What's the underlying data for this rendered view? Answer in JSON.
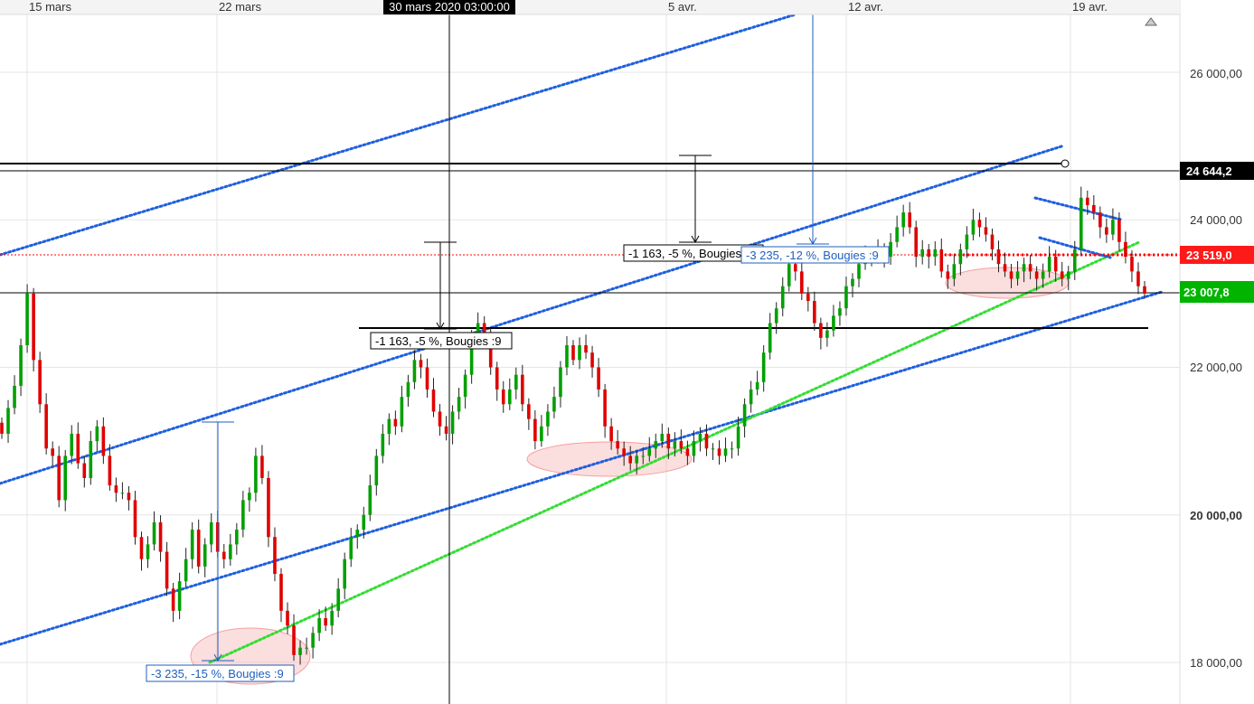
{
  "chart_data": {
    "type": "candlestick",
    "x_ticks": [
      "15 mars",
      "22 mars",
      "5 avr.",
      "12 avr.",
      "19 avr."
    ],
    "crosshair_label": "30 mars 2020 03:00:00",
    "y_ticks": [
      "26 000,00",
      "24 000,00",
      "22 000,00",
      "20 000,00",
      "18 000,00"
    ],
    "y_tick_values": [
      26000,
      24000,
      22000,
      20000,
      18000
    ],
    "ylim": [
      17500,
      26800
    ],
    "price_tags": [
      {
        "label": "24 644,2",
        "value": 24644.2,
        "color": "#000000"
      },
      {
        "label": "23 519,0",
        "value": 23519.0,
        "color": "#ff0000"
      },
      {
        "label": "23 007,8",
        "value": 23007.8,
        "color": "#00b400"
      }
    ],
    "annotations": [
      {
        "text": "-1 163, -5 %, Bougies :9",
        "color": "#000000"
      },
      {
        "text": "-1 163, -5 %, Bougies :9",
        "color": "#000000"
      },
      {
        "text": "-3 235, -12 %, Bougies :9",
        "color": "#1f5fbf"
      },
      {
        "text": "-3 235, -15 %, Bougies :9",
        "color": "#1f5fbf"
      }
    ],
    "colors": {
      "up": "#00a000",
      "down": "#e00000",
      "channel": "#1f5fdf",
      "support": "#33dd33",
      "ellipse": "#f4a0a0"
    },
    "closes": [
      21100,
      21450,
      21750,
      22300,
      23000,
      22100,
      21500,
      20900,
      20800,
      20200,
      20800,
      21100,
      20700,
      20500,
      21000,
      21200,
      20800,
      20400,
      20300,
      20300,
      20200,
      19700,
      19400,
      19600,
      19900,
      19500,
      19000,
      18700,
      19100,
      19400,
      19800,
      19300,
      19600,
      19900,
      19500,
      19400,
      19600,
      19800,
      20200,
      20300,
      20800,
      20500,
      19700,
      19200,
      18700,
      18500,
      18100,
      18200,
      18200,
      18400,
      18600,
      18500,
      18700,
      19000,
      19400,
      19700,
      19800,
      20000,
      20400,
      20800,
      21100,
      21300,
      21200,
      21600,
      21800,
      22100,
      22000,
      21700,
      21400,
      21200,
      21100,
      21400,
      21600,
      21900,
      22400,
      22600,
      22400,
      22000,
      21700,
      21500,
      21700,
      21900,
      21500,
      21300,
      21000,
      21200,
      21400,
      21600,
      22000,
      22300,
      22100,
      22300,
      22200,
      22000,
      21700,
      21200,
      21000,
      20900,
      20800,
      20700,
      20800,
      20800,
      20900,
      21000,
      21100,
      20900,
      21000,
      20900,
      20800,
      21000,
      21100,
      20900,
      20900,
      20800,
      20900,
      20900,
      21200,
      21500,
      21700,
      21800,
      22200,
      22600,
      22800,
      23100,
      23400,
      23300,
      23000,
      22900,
      22600,
      22400,
      22500,
      22700,
      22800,
      23100,
      23200,
      23400,
      23500,
      23500,
      23600,
      23500,
      23700,
      23900,
      24100,
      23900,
      23500,
      23600,
      23500,
      23600,
      23300,
      23200,
      23400,
      23600,
      23800,
      24000,
      23900,
      23800,
      23600,
      23400,
      23300,
      23200,
      23300,
      23400,
      23300,
      23200,
      23300,
      23500,
      23300,
      23200,
      23300,
      23600,
      24300,
      24200,
      24100,
      23900,
      23800,
      24000,
      23700,
      23500,
      23300,
      23100,
      23000
    ]
  }
}
